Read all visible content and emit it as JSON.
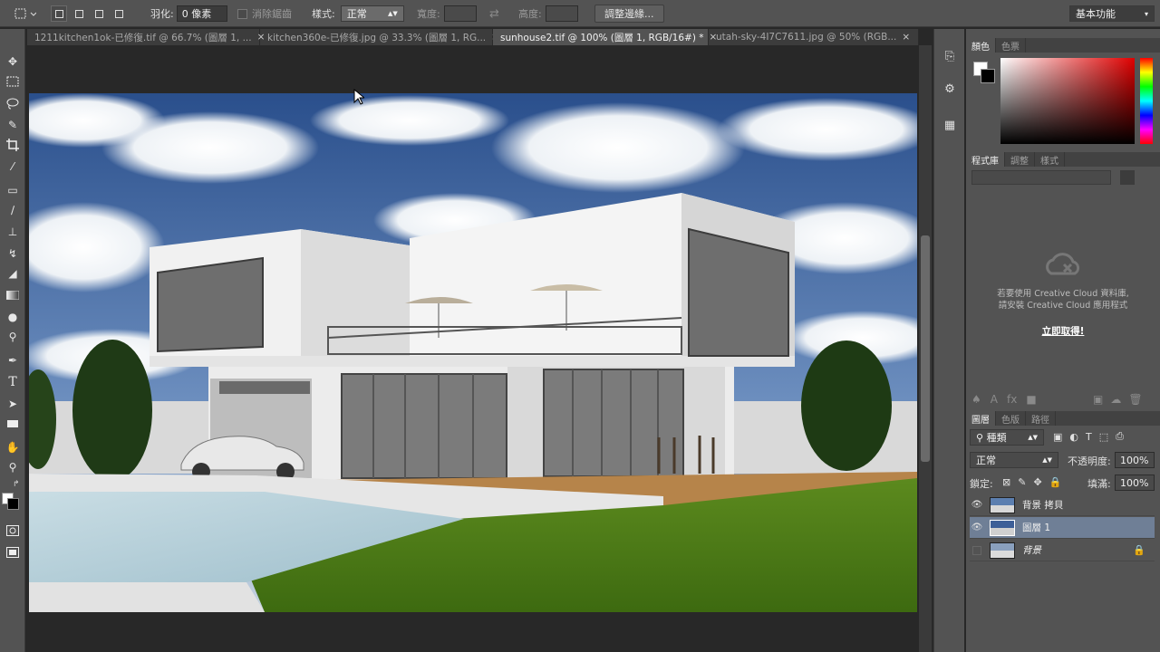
{
  "options_bar": {
    "feather_label": "羽化:",
    "feather_value": "0 像素",
    "antialias_label": "消除鋸齒",
    "style_label": "樣式:",
    "style_value": "正常",
    "width_label": "寬度:",
    "height_label": "高度:",
    "refine_edge_button": "調整邊緣...",
    "workspace_value": "基本功能"
  },
  "tabs": [
    {
      "label": "1211kitchen1ok-已修復.tif @ 66.7% (圖層 1, ...",
      "close": "×"
    },
    {
      "label": "kitchen360e-已修復.jpg @ 33.3% (圖層 1, RG...",
      "close": "×"
    },
    {
      "label": "sunhouse2.tif @ 100% (圖層 1, RGB/16#) *",
      "close": "×"
    },
    {
      "label": "utah-sky-4I7C7611.jpg @ 50% (RGB...",
      "close": "×"
    }
  ],
  "color_panel": {
    "tabs": [
      "顏色",
      "色票"
    ]
  },
  "library_panel": {
    "tabs": [
      "程式庫",
      "調整",
      "樣式"
    ],
    "message_line1": "若要使用 Creative Cloud 資料庫,",
    "message_line2": "請安裝 Creative Cloud 應用程式",
    "link": "立即取得!"
  },
  "layers_panel": {
    "tabs": [
      "圖層",
      "色版",
      "路徑"
    ],
    "kind_filter": "種類",
    "blend_mode": "正常",
    "opacity_label": "不透明度:",
    "opacity_value": "100%",
    "lock_label": "鎖定:",
    "fill_label": "填滿:",
    "fill_value": "100%",
    "layers": [
      {
        "name": "背景 拷貝",
        "visible": true,
        "selected": false,
        "locked": false
      },
      {
        "name": "圖層 1",
        "visible": true,
        "selected": true,
        "locked": false
      },
      {
        "name": "背景",
        "visible": false,
        "selected": false,
        "locked": true
      }
    ]
  },
  "colors": {
    "accent_selection": "#6f7f96",
    "link": "#ffffff"
  }
}
